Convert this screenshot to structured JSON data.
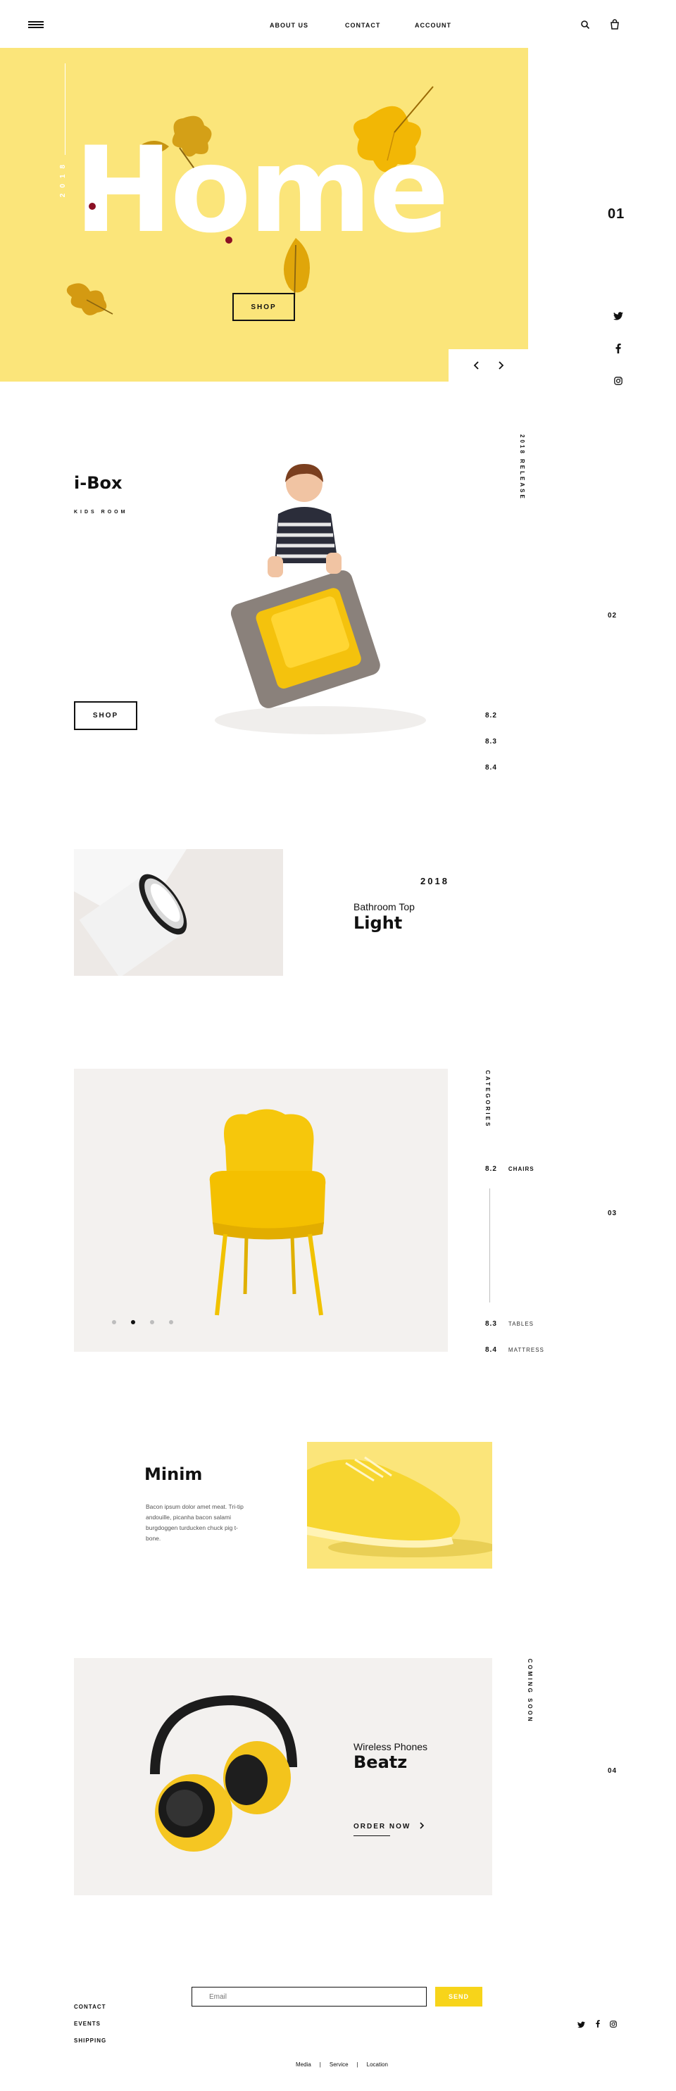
{
  "header": {
    "nav": [
      "ABOUT US",
      "CONTACT",
      "ACCOUNT"
    ]
  },
  "hero": {
    "year": "2018",
    "title": "Home",
    "button": "SHOP",
    "slide_number": "01",
    "accent_color": "#fbe57a"
  },
  "social": [
    "twitter-icon",
    "facebook-icon",
    "instagram-icon"
  ],
  "section_ibox": {
    "title": "i-Box",
    "subtitle": "KIDS ROOM",
    "release": "2018 RELEASE",
    "button": "SHOP",
    "section_number": "02",
    "sub_numbers": [
      "8.2",
      "8.3",
      "8.4"
    ]
  },
  "section_light": {
    "year": "2018",
    "kicker": "Bathroom Top",
    "title": "Light"
  },
  "section_categories": {
    "vertical_label": "CATEGORIES",
    "section_number": "03",
    "items": [
      {
        "num": "8.2",
        "label": "CHAIRS"
      },
      {
        "num": "8.3",
        "label": "TABLES"
      },
      {
        "num": "8.4",
        "label": "MATTRESS"
      }
    ]
  },
  "section_minim": {
    "title": "Minim",
    "body": "Bacon ipsum dolor amet meat. Tri-tip andouille, picanha bacon salami burgdoggen turducken chuck pig t-bone."
  },
  "section_beatz": {
    "kicker": "Wireless Phones",
    "title": "Beatz",
    "cta": "ORDER NOW",
    "vertical_label": "COMING SOON",
    "section_number": "04"
  },
  "footer": {
    "links": [
      "CONTACT",
      "EVENTS",
      "SHIPPING"
    ],
    "email_placeholder": "Email",
    "send": "SEND",
    "bottom_links": [
      "Media",
      "Service",
      "Location"
    ],
    "separator": "|"
  }
}
